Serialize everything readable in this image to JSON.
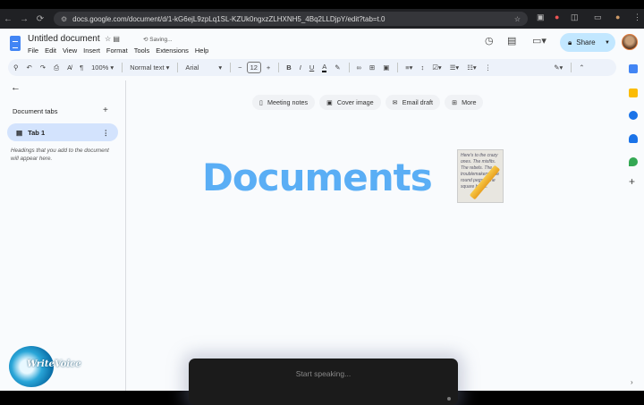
{
  "browser": {
    "url": "docs.google.com/document/d/1-kG6ejL9zpLq1SL-KZUk0ngxzZLHXNH5_4Bq2LLDjpY/edit?tab=t.0"
  },
  "doc": {
    "title": "Untitled document",
    "status": "Saving...",
    "menu": [
      "File",
      "Edit",
      "View",
      "Insert",
      "Format",
      "Tools",
      "Extensions",
      "Help"
    ],
    "share_label": "Share"
  },
  "toolbar": {
    "zoom": "100%",
    "style": "Normal text",
    "font": "Arial",
    "font_size": "12"
  },
  "sidebar": {
    "section_title": "Document tabs",
    "tab_label": "Tab 1",
    "hint": "Headings that you add to the document will appear here."
  },
  "chips": [
    {
      "label": "Meeting notes",
      "icon": "document-icon"
    },
    {
      "label": "Cover image",
      "icon": "image-icon"
    },
    {
      "label": "Email draft",
      "icon": "email-icon"
    },
    {
      "label": "More",
      "icon": "more-icon"
    }
  ],
  "content": {
    "heading": "Documents",
    "memo_text": "Here's to the crazy ones. The misfits. The rebels. The troublemakers. The round pegs in the square holes."
  },
  "voice": {
    "placeholder": "Start speaking..."
  },
  "brand": {
    "logo_text": "WriteVoice"
  },
  "colors": {
    "accent": "#c2e7ff",
    "heading": "#5aaef5",
    "selected_tab": "#d3e3fd"
  }
}
